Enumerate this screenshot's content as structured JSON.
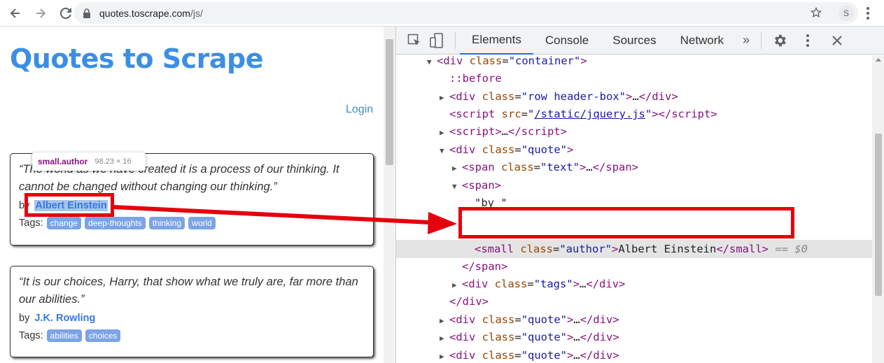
{
  "browser": {
    "url_host": "quotes.toscrape.com",
    "url_path": "/js/",
    "avatar_letter": "S"
  },
  "page": {
    "site_title": "Quotes to Scrape",
    "login_label": "Login",
    "by_label": "by",
    "tags_label": "Tags:",
    "quotes": [
      {
        "text": "“The world as we have created it is a process of our thinking. It cannot be changed without changing our thinking.”",
        "author": "Albert Einstein",
        "tags": [
          "change",
          "deep-thoughts",
          "thinking",
          "world"
        ]
      },
      {
        "text": "“It is our choices, Harry, that show what we truly are, far more than our abilities.”",
        "author": "J.K. Rowling",
        "tags": [
          "abilities",
          "choices"
        ]
      }
    ],
    "tooltip": {
      "tag": "small.author",
      "dims": "98.23 × 16"
    }
  },
  "devtools": {
    "tabs": [
      "Elements",
      "Console",
      "Sources",
      "Network"
    ],
    "more_tabs": "»",
    "active_tab": "Elements",
    "dollar0": "== $0"
  },
  "colors": {
    "accent": "#3c8ee4",
    "annotation": "#e5000d",
    "tag_bg": "#7ca3e6"
  }
}
